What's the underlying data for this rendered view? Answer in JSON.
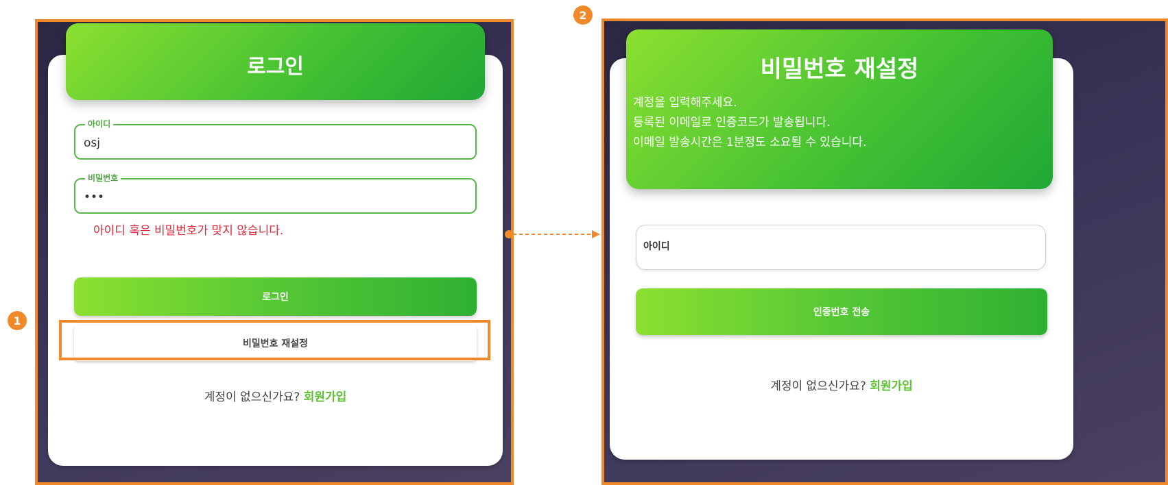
{
  "steps": [
    "1",
    "2"
  ],
  "login": {
    "title": "로그인",
    "username": {
      "legend": "아이디",
      "value": "osj"
    },
    "password": {
      "legend": "비밀번호",
      "value": "•••"
    },
    "error_message": "아이디 혹은 비밀번호가 맞지 않습니다.",
    "login_button": "로그인",
    "reset_button": "비밀번호 재설정",
    "signup_prompt": "계정이 없으신가요?",
    "signup_link": "회원가입"
  },
  "reset": {
    "title": "비밀번호 재설정",
    "description": [
      "계정을 입력해주세요.",
      "등록된 이메일로 인증코드가 발송됩니다.",
      "이메일 발송시간은 1분정도 소요될 수 있습니다."
    ],
    "id_placeholder": "아이디",
    "send_button": "인증번호 전송",
    "signup_prompt": "계정이 없으신가요?",
    "signup_link": "회원가입"
  },
  "colors": {
    "highlight": "#f0892a",
    "accent_green": "#46c233",
    "error_red": "#e0283a"
  }
}
